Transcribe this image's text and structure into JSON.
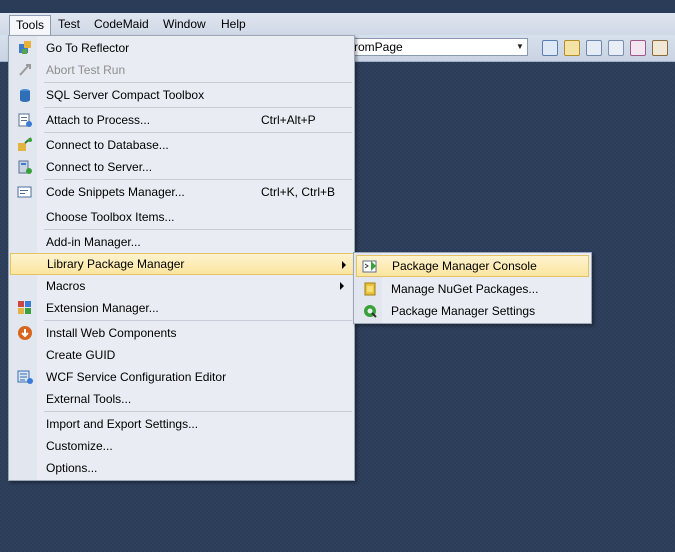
{
  "menubar": {
    "items": [
      {
        "label": "Tools",
        "active": true
      },
      {
        "label": "Test"
      },
      {
        "label": "CodeMaid"
      },
      {
        "label": "Window"
      },
      {
        "label": "Help"
      }
    ]
  },
  "toolbar": {
    "combo_value": "romPage"
  },
  "tools_menu": {
    "items": [
      {
        "label": "Go To Reflector",
        "icon": "reflector-icon"
      },
      {
        "label": "Abort Test Run",
        "icon": "abort-test-icon",
        "disabled": true
      },
      {
        "label": "SQL Server Compact Toolbox",
        "icon": "database-toolbox-icon"
      },
      {
        "label": "Attach to Process...",
        "shortcut": "Ctrl+Alt+P",
        "icon": "attach-process-icon"
      },
      {
        "label": "Connect to Database...",
        "icon": "connect-database-icon"
      },
      {
        "label": "Connect to Server...",
        "icon": "connect-server-icon"
      },
      {
        "label": "Code Snippets Manager...",
        "shortcut": "Ctrl+K, Ctrl+B",
        "icon": "snippets-icon"
      },
      {
        "label": "Choose Toolbox Items..."
      },
      {
        "label": "Add-in Manager..."
      },
      {
        "label": "Library Package Manager",
        "submenu": true
      },
      {
        "label": "Macros",
        "submenu": true
      },
      {
        "label": "Extension Manager...",
        "icon": "extension-manager-icon"
      },
      {
        "label": "Install Web Components",
        "icon": "install-web-icon"
      },
      {
        "label": "Create GUID"
      },
      {
        "label": "WCF Service Configuration Editor",
        "icon": "wcf-editor-icon"
      },
      {
        "label": "External Tools..."
      },
      {
        "label": "Import and Export Settings..."
      },
      {
        "label": "Customize..."
      },
      {
        "label": "Options..."
      }
    ]
  },
  "package_submenu": {
    "items": [
      {
        "label": "Package Manager Console",
        "icon": "console-icon"
      },
      {
        "label": "Manage NuGet Packages...",
        "icon": "nuget-icon"
      },
      {
        "label": "Package Manager Settings",
        "icon": "settings-icon"
      }
    ]
  }
}
